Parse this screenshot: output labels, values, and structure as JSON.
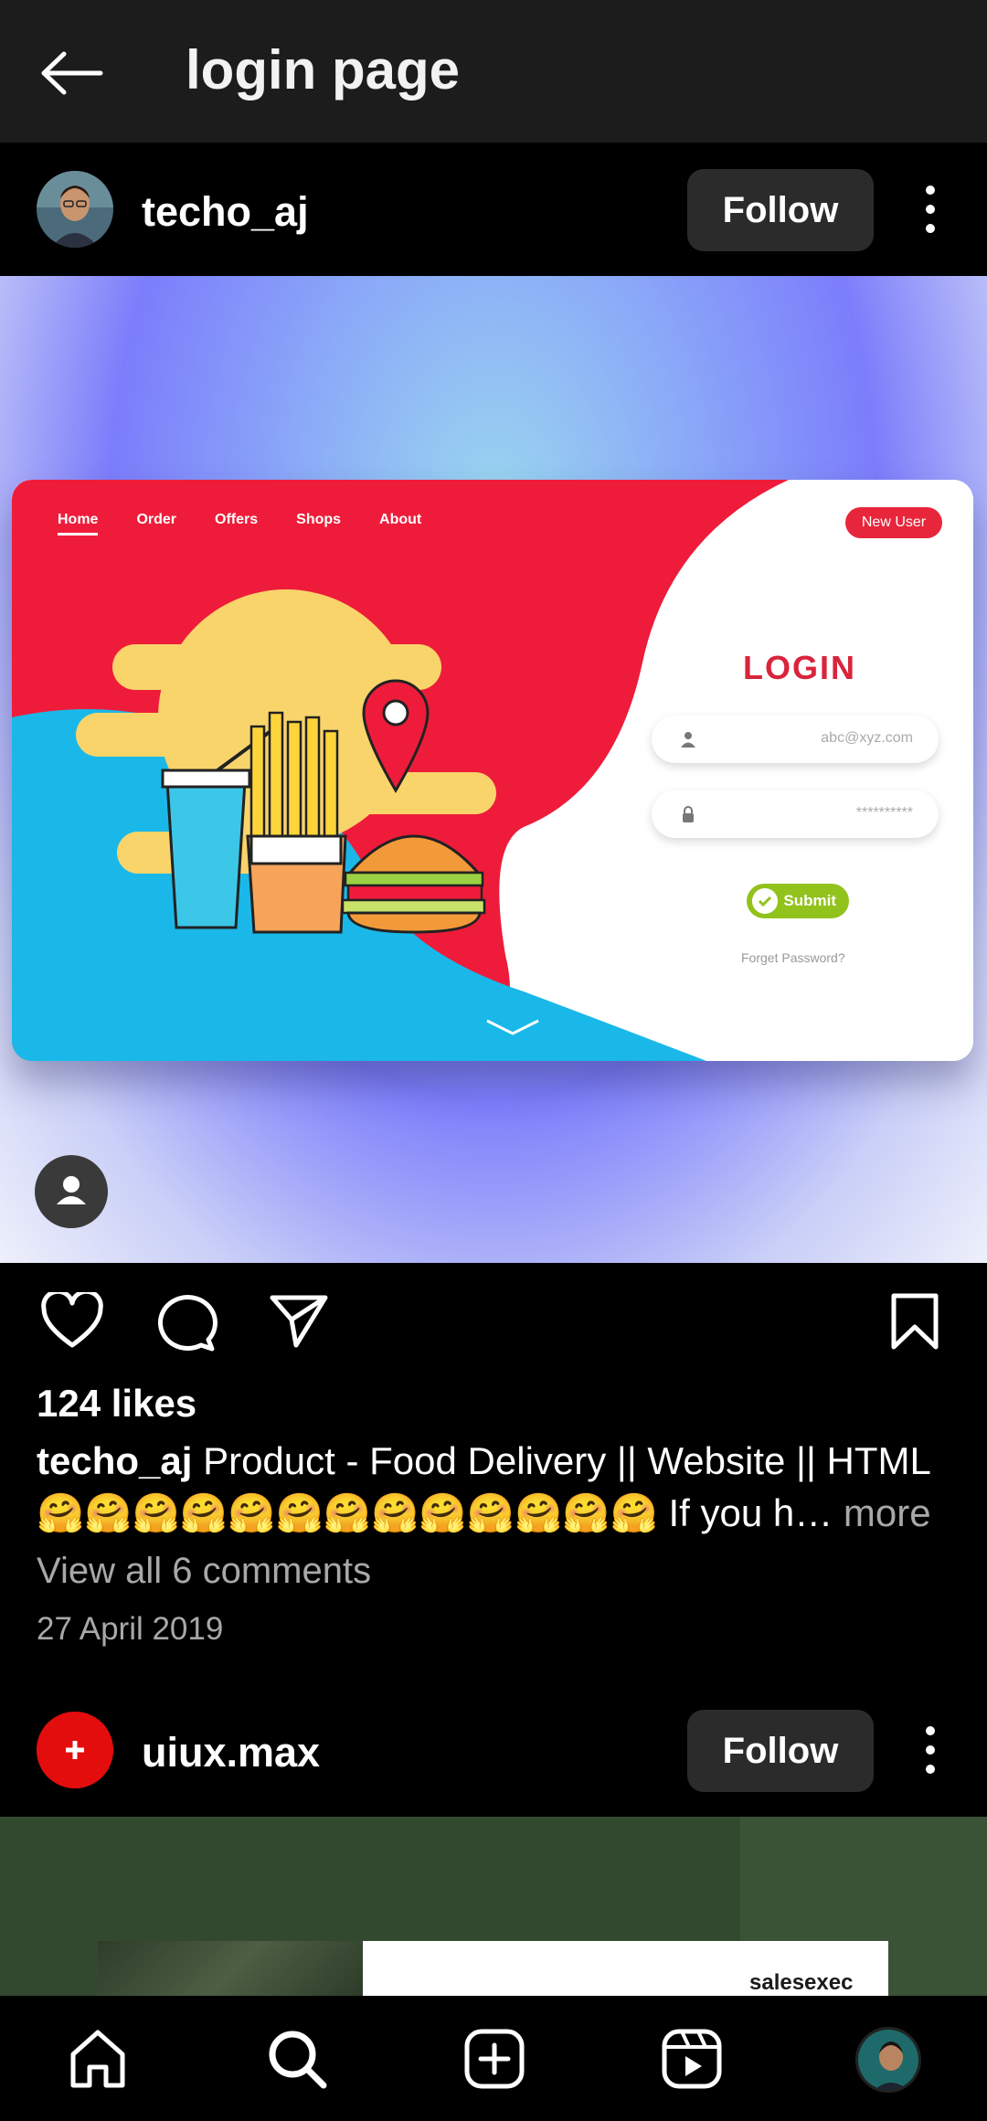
{
  "header": {
    "title": "login page",
    "back_icon": "arrow-left-icon"
  },
  "posts": [
    {
      "username": "techo_aj",
      "follow_label": "Follow",
      "media": {
        "nav": [
          "Home",
          "Order",
          "Offers",
          "Shops",
          "About"
        ],
        "new_user_label": "New User",
        "login_title": "LOGIN",
        "email_placeholder": "abc@xyz.com",
        "password_placeholder": "**********",
        "submit_label": "Submit",
        "forgot_label": "Forget Password?"
      },
      "likes": "124 likes",
      "caption_user": "techo_aj",
      "caption_text": "Product - Food Delivery || Website || HTML 🤗🤗🤗🤗🤗🤗🤗🤗🤗🤗🤗🤗🤗 If you h…",
      "caption_more": " more",
      "view_comments": "View all 6 comments",
      "date": "27 April 2019"
    },
    {
      "username": "uiux.max",
      "follow_label": "Follow",
      "media_brand": "salesexec"
    }
  ],
  "colors": {
    "bar_bg": "#1c1c1c",
    "follow_bg": "#2b2b2b",
    "accent_red": "#e8263b",
    "submit_green": "#92c21c"
  },
  "bottom_nav": [
    "home-icon",
    "search-icon",
    "create-icon",
    "reels-icon",
    "profile-avatar"
  ]
}
